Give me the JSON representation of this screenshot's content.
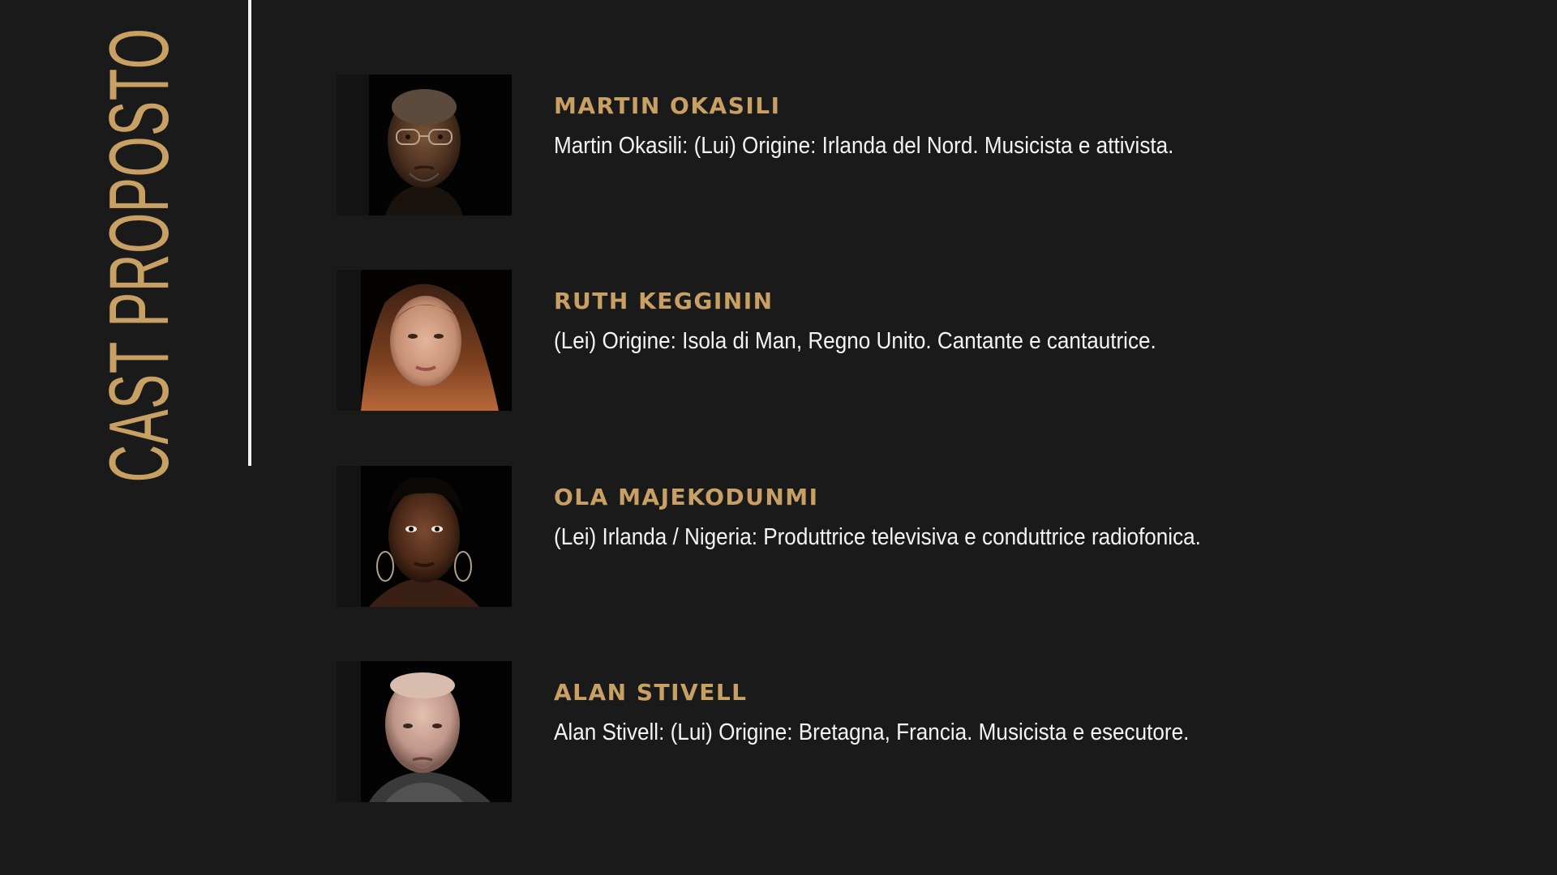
{
  "slide": {
    "title": "CAST PROPOSTO",
    "colors": {
      "background": "#1b1a1b",
      "accent": "#c9a063",
      "text": "#f4f4f4",
      "divider": "#f2f2f2"
    },
    "cast": [
      {
        "name": "MARTIN OKASILI",
        "description": "Martin Okasili: (Lui) Origine: Irlanda del Nord. Musicista e attivista.",
        "portrait": "portrait-photo"
      },
      {
        "name": "RUTH KEGGININ",
        "description": "(Lei) Origine: Isola di Man, Regno Unito. Cantante e cantautrice.",
        "portrait": "portrait-photo"
      },
      {
        "name": "OLA MAJEKODUNMI",
        "description": "(Lei) Irlanda / Nigeria: Produttrice televisiva e conduttrice radiofonica.",
        "portrait": "portrait-photo"
      },
      {
        "name": "ALAN STIVELL",
        "description": "Alan Stivell: (Lui) Origine: Bretagna, Francia. Musicista e esecutore.",
        "portrait": "portrait-photo"
      }
    ]
  }
}
